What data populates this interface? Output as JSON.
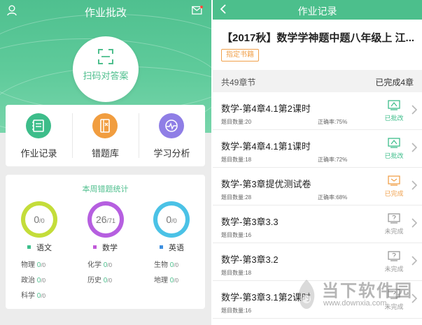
{
  "left": {
    "title": "作业批改",
    "scan_label": "扫码对答案",
    "menu": [
      {
        "label": "作业记录",
        "icon": "notebook-icon",
        "color": "#3dbd8a"
      },
      {
        "label": "错题库",
        "icon": "wrong-book-icon",
        "color": "#f19d3f"
      },
      {
        "label": "学习分析",
        "icon": "analysis-icon",
        "color": "#8f7ee6"
      }
    ],
    "stats": {
      "title": "本周错题统计",
      "rings": [
        {
          "big": "0",
          "small": "/0",
          "subject": "语文",
          "color": "#c4dd3a",
          "dot": "#3cbf8c",
          "progress": 0
        },
        {
          "big": "26",
          "small": "/71",
          "subject": "数学",
          "color": "#b65fe0",
          "dot": "#c05ad8",
          "progress": 0.37
        },
        {
          "big": "0",
          "small": "/0",
          "subject": "英语",
          "color": "#4bc2e6",
          "dot": "#3d8fe0",
          "progress": 0
        }
      ],
      "subjects": [
        {
          "name": "物理",
          "big": "0",
          "small": "/0"
        },
        {
          "name": "化学",
          "big": "0",
          "small": "/0"
        },
        {
          "name": "生物",
          "big": "0",
          "small": "/0"
        },
        {
          "name": "政治",
          "big": "0",
          "small": "/0"
        },
        {
          "name": "历史",
          "big": "0",
          "small": "/0"
        },
        {
          "name": "地理",
          "big": "0",
          "small": "/0"
        },
        {
          "name": "科学",
          "big": "0",
          "small": "/0"
        }
      ]
    }
  },
  "right": {
    "title": "作业记录",
    "book_title": "【2017秋】数学学神题中题八年级上 江...",
    "tag": "指定书籍",
    "summary_left": "共49章节",
    "summary_right": "已完成4章",
    "count_label": "题目数量:",
    "accuracy_label": "正确率:",
    "rows": [
      {
        "title": "数学-第4章4.1第2课时",
        "count": "20",
        "accuracy": "75%",
        "status": "已批改",
        "status_color": "#3dbd8a"
      },
      {
        "title": "数学-第4章4.1第1课时",
        "count": "18",
        "accuracy": "72%",
        "status": "已批改",
        "status_color": "#3dbd8a"
      },
      {
        "title": "数学-第3章提优测试卷",
        "count": "28",
        "accuracy": "68%",
        "status": "已完成",
        "status_color": "#f0a04b"
      },
      {
        "title": "数学-第3章3.3",
        "count": "16",
        "accuracy": "",
        "status": "未完成",
        "status_color": "#999999"
      },
      {
        "title": "数学-第3章3.2",
        "count": "18",
        "accuracy": "",
        "status": "未完成",
        "status_color": "#999999"
      },
      {
        "title": "数学-第3章3.1第2课时",
        "count": "16",
        "accuracy": "",
        "status": "未完成",
        "status_color": "#999999"
      }
    ]
  },
  "watermark": {
    "title": "当下软件园",
    "url": "www.downxia.com"
  }
}
